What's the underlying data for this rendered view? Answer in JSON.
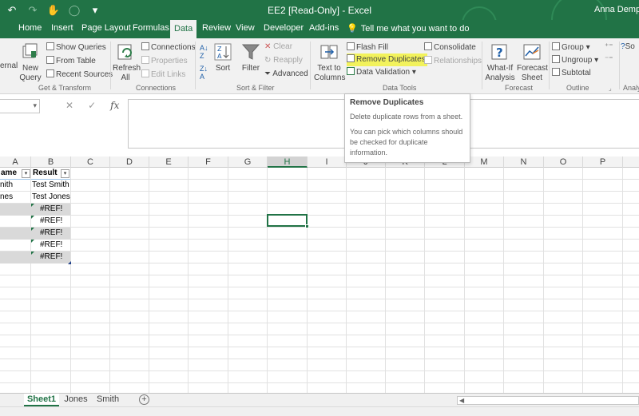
{
  "title": "EE2  [Read-Only]  -  Excel",
  "user": "Anna Dempsey",
  "tabs": [
    "Home",
    "Insert",
    "Page Layout",
    "Formulas",
    "Data",
    "Review",
    "View",
    "Developer",
    "Add-ins"
  ],
  "active_tab": "Data",
  "tell_me": "Tell me what you want to do",
  "ribbon": {
    "get_transform": {
      "label": "Get & Transform",
      "new_query": "New\nQuery",
      "external": "ernal",
      "show_queries": "Show Queries",
      "from_table": "From Table",
      "recent_sources": "Recent Sources"
    },
    "connections": {
      "label": "Connections",
      "refresh_all": "Refresh\nAll",
      "connections": "Connections",
      "properties": "Properties",
      "edit_links": "Edit Links"
    },
    "sort_filter": {
      "label": "Sort & Filter",
      "sort": "Sort",
      "filter": "Filter",
      "clear": "Clear",
      "reapply": "Reapply",
      "advanced": "Advanced"
    },
    "data_tools": {
      "label": "Data Tools",
      "text_to_columns": "Text to\nColumns",
      "flash_fill": "Flash Fill",
      "remove_duplicates": "Remove Duplicates",
      "data_validation": "Data Validation",
      "consolidate": "Consolidate",
      "relationships": "Relationships"
    },
    "forecast": {
      "label": "Forecast",
      "what_if": "What-If\nAnalysis",
      "forecast_sheet": "Forecast\nSheet"
    },
    "outline": {
      "label": "Outline",
      "group": "Group",
      "ungroup": "Ungroup",
      "subtotal": "Subtotal"
    },
    "analysis_label": "Analy",
    "so": "So"
  },
  "tooltip": {
    "title": "Remove Duplicates",
    "desc": "Delete duplicate rows from a sheet.",
    "detail": "You can pick which columns should be checked for duplicate information."
  },
  "columns": [
    "A",
    "B",
    "C",
    "D",
    "E",
    "F",
    "G",
    "H",
    "I",
    "J",
    "K",
    "L",
    "M",
    "N",
    "O",
    "P"
  ],
  "selected_column": "H",
  "sheet": {
    "header_a": "ame",
    "header_b": "Result",
    "rows": [
      {
        "a": "nith",
        "b": "Test Smith"
      },
      {
        "a": "nes",
        "b": "Test Jones"
      },
      {
        "a": "",
        "b": "#REF!"
      },
      {
        "a": "",
        "b": "#REF!"
      },
      {
        "a": "",
        "b": "#REF!"
      },
      {
        "a": "",
        "b": "#REF!"
      },
      {
        "a": "",
        "b": "#REF!"
      }
    ]
  },
  "sheet_tabs": [
    "Sheet1",
    "Jones",
    "Smith"
  ],
  "active_sheet": "Sheet1",
  "add_sheet": "+",
  "colors": {
    "excel_green": "#217346",
    "ribbon_bg": "#f1f1f1",
    "highlight": "#f2f25c",
    "band_gray": "#d9d9d9"
  }
}
